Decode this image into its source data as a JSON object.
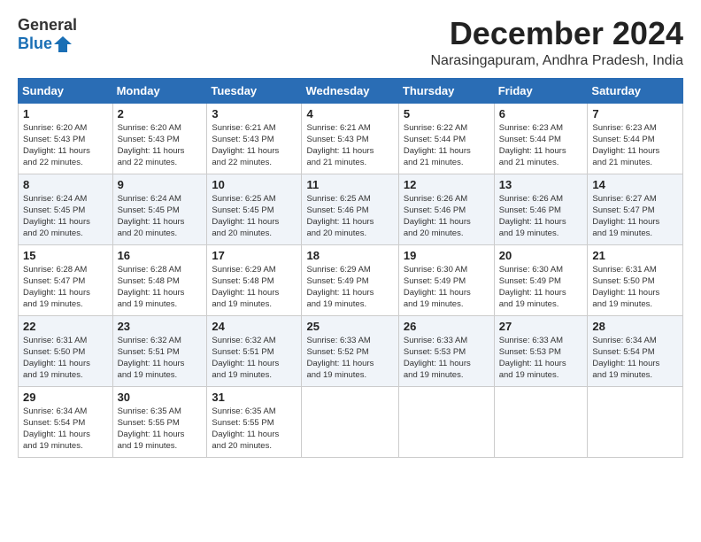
{
  "logo": {
    "line1": "General",
    "line2": "Blue"
  },
  "header": {
    "month_year": "December 2024",
    "location": "Narasingapuram, Andhra Pradesh, India"
  },
  "days_of_week": [
    "Sunday",
    "Monday",
    "Tuesday",
    "Wednesday",
    "Thursday",
    "Friday",
    "Saturday"
  ],
  "weeks": [
    [
      {
        "day": "1",
        "detail": "Sunrise: 6:20 AM\nSunset: 5:43 PM\nDaylight: 11 hours\nand 22 minutes."
      },
      {
        "day": "2",
        "detail": "Sunrise: 6:20 AM\nSunset: 5:43 PM\nDaylight: 11 hours\nand 22 minutes."
      },
      {
        "day": "3",
        "detail": "Sunrise: 6:21 AM\nSunset: 5:43 PM\nDaylight: 11 hours\nand 22 minutes."
      },
      {
        "day": "4",
        "detail": "Sunrise: 6:21 AM\nSunset: 5:43 PM\nDaylight: 11 hours\nand 21 minutes."
      },
      {
        "day": "5",
        "detail": "Sunrise: 6:22 AM\nSunset: 5:44 PM\nDaylight: 11 hours\nand 21 minutes."
      },
      {
        "day": "6",
        "detail": "Sunrise: 6:23 AM\nSunset: 5:44 PM\nDaylight: 11 hours\nand 21 minutes."
      },
      {
        "day": "7",
        "detail": "Sunrise: 6:23 AM\nSunset: 5:44 PM\nDaylight: 11 hours\nand 21 minutes."
      }
    ],
    [
      {
        "day": "8",
        "detail": "Sunrise: 6:24 AM\nSunset: 5:45 PM\nDaylight: 11 hours\nand 20 minutes."
      },
      {
        "day": "9",
        "detail": "Sunrise: 6:24 AM\nSunset: 5:45 PM\nDaylight: 11 hours\nand 20 minutes."
      },
      {
        "day": "10",
        "detail": "Sunrise: 6:25 AM\nSunset: 5:45 PM\nDaylight: 11 hours\nand 20 minutes."
      },
      {
        "day": "11",
        "detail": "Sunrise: 6:25 AM\nSunset: 5:46 PM\nDaylight: 11 hours\nand 20 minutes."
      },
      {
        "day": "12",
        "detail": "Sunrise: 6:26 AM\nSunset: 5:46 PM\nDaylight: 11 hours\nand 20 minutes."
      },
      {
        "day": "13",
        "detail": "Sunrise: 6:26 AM\nSunset: 5:46 PM\nDaylight: 11 hours\nand 19 minutes."
      },
      {
        "day": "14",
        "detail": "Sunrise: 6:27 AM\nSunset: 5:47 PM\nDaylight: 11 hours\nand 19 minutes."
      }
    ],
    [
      {
        "day": "15",
        "detail": "Sunrise: 6:28 AM\nSunset: 5:47 PM\nDaylight: 11 hours\nand 19 minutes."
      },
      {
        "day": "16",
        "detail": "Sunrise: 6:28 AM\nSunset: 5:48 PM\nDaylight: 11 hours\nand 19 minutes."
      },
      {
        "day": "17",
        "detail": "Sunrise: 6:29 AM\nSunset: 5:48 PM\nDaylight: 11 hours\nand 19 minutes."
      },
      {
        "day": "18",
        "detail": "Sunrise: 6:29 AM\nSunset: 5:49 PM\nDaylight: 11 hours\nand 19 minutes."
      },
      {
        "day": "19",
        "detail": "Sunrise: 6:30 AM\nSunset: 5:49 PM\nDaylight: 11 hours\nand 19 minutes."
      },
      {
        "day": "20",
        "detail": "Sunrise: 6:30 AM\nSunset: 5:49 PM\nDaylight: 11 hours\nand 19 minutes."
      },
      {
        "day": "21",
        "detail": "Sunrise: 6:31 AM\nSunset: 5:50 PM\nDaylight: 11 hours\nand 19 minutes."
      }
    ],
    [
      {
        "day": "22",
        "detail": "Sunrise: 6:31 AM\nSunset: 5:50 PM\nDaylight: 11 hours\nand 19 minutes."
      },
      {
        "day": "23",
        "detail": "Sunrise: 6:32 AM\nSunset: 5:51 PM\nDaylight: 11 hours\nand 19 minutes."
      },
      {
        "day": "24",
        "detail": "Sunrise: 6:32 AM\nSunset: 5:51 PM\nDaylight: 11 hours\nand 19 minutes."
      },
      {
        "day": "25",
        "detail": "Sunrise: 6:33 AM\nSunset: 5:52 PM\nDaylight: 11 hours\nand 19 minutes."
      },
      {
        "day": "26",
        "detail": "Sunrise: 6:33 AM\nSunset: 5:53 PM\nDaylight: 11 hours\nand 19 minutes."
      },
      {
        "day": "27",
        "detail": "Sunrise: 6:33 AM\nSunset: 5:53 PM\nDaylight: 11 hours\nand 19 minutes."
      },
      {
        "day": "28",
        "detail": "Sunrise: 6:34 AM\nSunset: 5:54 PM\nDaylight: 11 hours\nand 19 minutes."
      }
    ],
    [
      {
        "day": "29",
        "detail": "Sunrise: 6:34 AM\nSunset: 5:54 PM\nDaylight: 11 hours\nand 19 minutes."
      },
      {
        "day": "30",
        "detail": "Sunrise: 6:35 AM\nSunset: 5:55 PM\nDaylight: 11 hours\nand 19 minutes."
      },
      {
        "day": "31",
        "detail": "Sunrise: 6:35 AM\nSunset: 5:55 PM\nDaylight: 11 hours\nand 20 minutes."
      },
      {
        "day": "",
        "detail": ""
      },
      {
        "day": "",
        "detail": ""
      },
      {
        "day": "",
        "detail": ""
      },
      {
        "day": "",
        "detail": ""
      }
    ]
  ]
}
